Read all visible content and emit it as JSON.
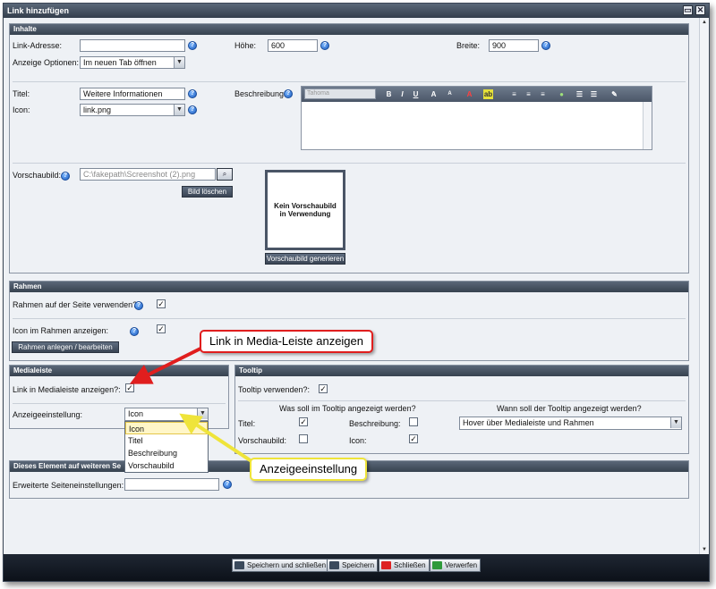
{
  "window": {
    "title": "Link hinzufügen",
    "btn_restore": "▭",
    "btn_close": "✕"
  },
  "inhalte": {
    "header": "Inhalte",
    "link_address_label": "Link-Adresse:",
    "link_address_value": "",
    "height_label": "Höhe:",
    "height_value": "600",
    "width_label": "Breite:",
    "width_value": "900",
    "display_options_label": "Anzeige Optionen:",
    "display_options_value": "Im neuen Tab öffnen",
    "title_label": "Titel:",
    "title_value": "Weitere Informationen",
    "icon_label": "Icon:",
    "icon_value": "link.png",
    "description_label": "Beschreibung:",
    "editor_font_placeholder": "Tahoma",
    "preview_image_label": "Vorschaubild:",
    "preview_image_path": "C:\\fakepath\\Screenshot (2).png",
    "delete_image_button": "Bild löschen",
    "preview_placeholder_text": "Kein Vorschaubild in Verwendung",
    "generate_preview_button": "Vorschaubild generieren"
  },
  "rahmen": {
    "header": "Rahmen",
    "use_frame_label": "Rahmen auf der Seite verwenden?:",
    "use_frame_checked": true,
    "icon_in_frame_label": "Icon im Rahmen anzeigen:",
    "icon_in_frame_checked": true,
    "create_frame_button": "Rahmen anlegen / bearbeiten"
  },
  "medialeiste": {
    "header": "Medialeiste",
    "link_in_media_label": "Link in Medialeiste anzeigen?:",
    "link_in_media_checked": true,
    "display_setting_label": "Anzeigeeinstellung:",
    "display_setting_value": "Icon",
    "display_setting_options": [
      "Icon",
      "Titel",
      "Beschreibung",
      "Vorschaubild"
    ]
  },
  "tooltip": {
    "header": "Tooltip",
    "use_tooltip_label": "Tooltip verwenden?:",
    "use_tooltip_checked": true,
    "what_shown_heading": "Was soll im Tooltip angezeigt werden?",
    "when_shown_heading": "Wann soll der Tooltip angezeigt werden?",
    "title_label": "Titel:",
    "title_checked": true,
    "description_label": "Beschreibung:",
    "description_checked": false,
    "preview_label": "Vorschaubild:",
    "preview_checked": false,
    "icon_label": "Icon:",
    "icon_checked": true,
    "when_value": "Hover über Medialeiste und Rahmen"
  },
  "other_pages": {
    "header": "Dieses Element auf weiteren Se",
    "extended_settings_label": "Erweiterte Seiteneinstellungen:",
    "extended_settings_value": ""
  },
  "footer": {
    "save_close": "Speichern und schließen",
    "save": "Speichern",
    "close": "Schließen",
    "discard": "Verwerfen"
  },
  "callouts": {
    "media_bar": "Link in Media-Leiste anzeigen",
    "display_setting": "Anzeigeeinstellung"
  },
  "colors": {
    "header_dark": "#37424f",
    "arrow_red": "#e01e1e",
    "arrow_yellow": "#efe43a",
    "help_blue": "#1b5bbf"
  }
}
